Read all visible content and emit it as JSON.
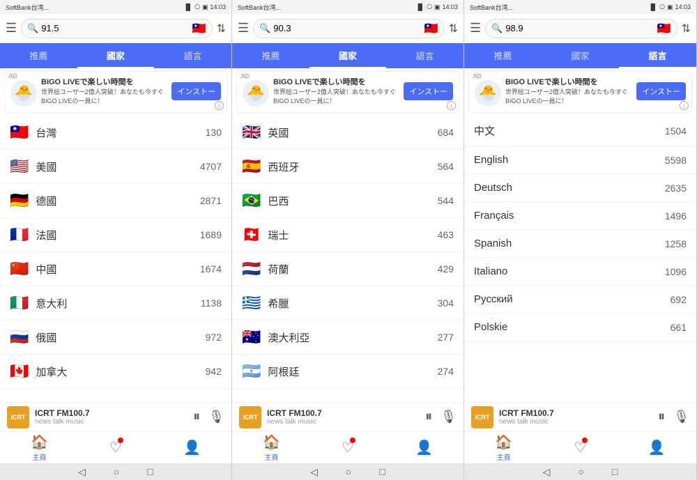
{
  "panels": [
    {
      "id": "panel1",
      "statusBar": {
        "carrier": "SoftBank台湾...",
        "signal": "📶",
        "bluetooth": "🔵",
        "battery": "🔋",
        "time": "14:03"
      },
      "searchValue": "91.5",
      "tabs": [
        "推薦",
        "國家",
        "語言"
      ],
      "activeTab": 1,
      "adTitle": "BIGO LIVEで楽しい時間を",
      "adSub": "世界総ユーザー2億人突破！あなたも今すぐBIGO LIVEの一員に！",
      "adButton": "インストー",
      "listItems": [
        {
          "flag": "🇹🇼",
          "name": "台灣",
          "count": "130"
        },
        {
          "flag": "🇺🇸",
          "name": "美國",
          "count": "4707"
        },
        {
          "flag": "🇩🇪",
          "name": "德國",
          "count": "2871"
        },
        {
          "flag": "🇫🇷",
          "name": "法國",
          "count": "1689"
        },
        {
          "flag": "🇨🇳",
          "name": "中國",
          "count": "1674"
        },
        {
          "flag": "🇮🇹",
          "name": "意大利",
          "count": "1138"
        },
        {
          "flag": "🇷🇺",
          "name": "俄國",
          "count": "972"
        },
        {
          "flag": "🇨🇦",
          "name": "加拿大",
          "count": "942"
        }
      ],
      "playerStation": "ICRT FM100.7",
      "playerSub": "news talk music",
      "navItems": [
        "主頁",
        "♡",
        "👤"
      ],
      "navActiveIndex": 0
    },
    {
      "id": "panel2",
      "statusBar": {
        "carrier": "SoftBank台湾...",
        "signal": "📶",
        "bluetooth": "🔵",
        "battery": "🔋",
        "time": "14:03"
      },
      "searchValue": "90.3",
      "tabs": [
        "推薦",
        "國家",
        "語言"
      ],
      "activeTab": 1,
      "adTitle": "BIGO LIVEで楽しい時間を",
      "adSub": "世界総ユーザー2億人突破！あなたも今すぐBIGO LIVEの一員に！",
      "adButton": "インストー",
      "listItems": [
        {
          "flag": "🇬🇧",
          "name": "英國",
          "count": "684"
        },
        {
          "flag": "🇪🇸",
          "name": "西班牙",
          "count": "564"
        },
        {
          "flag": "🇧🇷",
          "name": "巴西",
          "count": "544"
        },
        {
          "flag": "🇨🇭",
          "name": "瑞士",
          "count": "463"
        },
        {
          "flag": "🇳🇱",
          "name": "荷蘭",
          "count": "429"
        },
        {
          "flag": "🇬🇷",
          "name": "希臘",
          "count": "304"
        },
        {
          "flag": "🇦🇺",
          "name": "澳大利亞",
          "count": "277"
        },
        {
          "flag": "🇦🇷",
          "name": "阿根廷",
          "count": "274"
        }
      ],
      "playerStation": "ICRT FM100.7",
      "playerSub": "news talk music",
      "navItems": [
        "主頁",
        "♡",
        "👤"
      ],
      "navActiveIndex": 0
    },
    {
      "id": "panel3",
      "statusBar": {
        "carrier": "SoftBank台湾...",
        "signal": "📶",
        "bluetooth": "🔵",
        "battery": "🔋",
        "time": "14:03"
      },
      "searchValue": "98.9",
      "tabs": [
        "推薦",
        "國家",
        "語言"
      ],
      "activeTab": 2,
      "adTitle": "BIGO LIVEで楽しい時間を",
      "adSub": "世界総ユーザー2億人突破！あなたも今すぐBIGO LIVEの一員に！",
      "adButton": "インストー",
      "listItems": [
        {
          "flag": "",
          "name": "中文",
          "count": "1504"
        },
        {
          "flag": "",
          "name": "English",
          "count": "5598"
        },
        {
          "flag": "",
          "name": "Deutsch",
          "count": "2635"
        },
        {
          "flag": "",
          "name": "Français",
          "count": "1496"
        },
        {
          "flag": "",
          "name": "Spanish",
          "count": "1258"
        },
        {
          "flag": "",
          "name": "Italiano",
          "count": "1096"
        },
        {
          "flag": "",
          "name": "Русский",
          "count": "692"
        },
        {
          "flag": "",
          "name": "Polskie",
          "count": "661"
        }
      ],
      "playerStation": "ICRT FM100.7",
      "playerSub": "news talk music",
      "navItems": [
        "主頁",
        "♡",
        "👤"
      ],
      "navActiveIndex": 0
    }
  ],
  "adMascot": "🐣",
  "installLabel": "インストー",
  "infoLabel": "ⓘ",
  "playerLogoText": "ICRT",
  "pauseIcon": "⏸",
  "micIcon": "🎙",
  "homeIcon": "🏠",
  "heartIcon": "♡",
  "personIcon": "👤",
  "searchIcon": "🔍",
  "taiwanFlag": "🇹🇼",
  "hamburgerLabel": "☰",
  "filterLabel": "⇅",
  "backBtn": "◁",
  "circleBtn": "○",
  "squareBtn": "□"
}
